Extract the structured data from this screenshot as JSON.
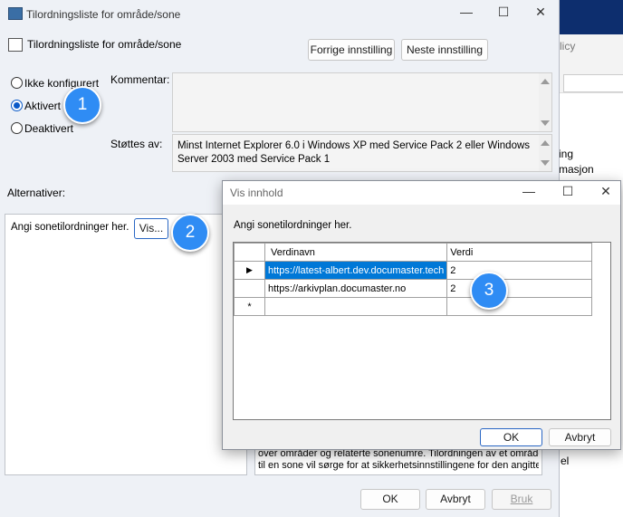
{
  "bg": {
    "right_text_1": "licy",
    "right_text_2": "ing",
    "right_text_3": "masjon",
    "right_text_4": "el"
  },
  "main_dialog": {
    "title": "Tilordningsliste for område/sone",
    "header_title": "Tilordningsliste for område/sone",
    "prev_setting": "Forrige innstilling",
    "next_setting": "Neste innstilling",
    "options": [
      {
        "label": "Ikke konfigurert",
        "checked": false
      },
      {
        "label": "Aktivert",
        "checked": true
      },
      {
        "label": "Deaktivert",
        "checked": false
      }
    ],
    "comment_label": "Kommentar:",
    "supported_label": "Støttes av:",
    "supported_text": "Minst Internet Explorer 6.0 i Windows XP med Service Pack 2 eller Windows Server 2003 med Service Pack 1",
    "alternatives_label": "Alternativer:",
    "zone_prompt": "Angi sonetilordninger her.",
    "show_button": "Vis...",
    "help_text_1": "over områder og relaterte sonenumre. Tilordningen av et område",
    "help_text_2": "til en sone vil sørge for at sikkerhetsinnstillingene for den angitte",
    "ok": "OK",
    "cancel": "Avbryt",
    "apply": "Bruk"
  },
  "show_dialog": {
    "title": "Vis innhold",
    "prompt": "Angi sonetilordninger her.",
    "columns": [
      "Verdinavn",
      "Verdi"
    ],
    "rows": [
      {
        "name": "https://latest-albert.dev.documaster.tech",
        "value": "2"
      },
      {
        "name": "https://arkivplan.documaster.no",
        "value": "2"
      }
    ],
    "ok": "OK",
    "cancel": "Avbryt"
  },
  "badges": [
    "1",
    "2",
    "3"
  ],
  "colors": {
    "accent": "#2f8cf4",
    "selection": "#0078d7"
  }
}
